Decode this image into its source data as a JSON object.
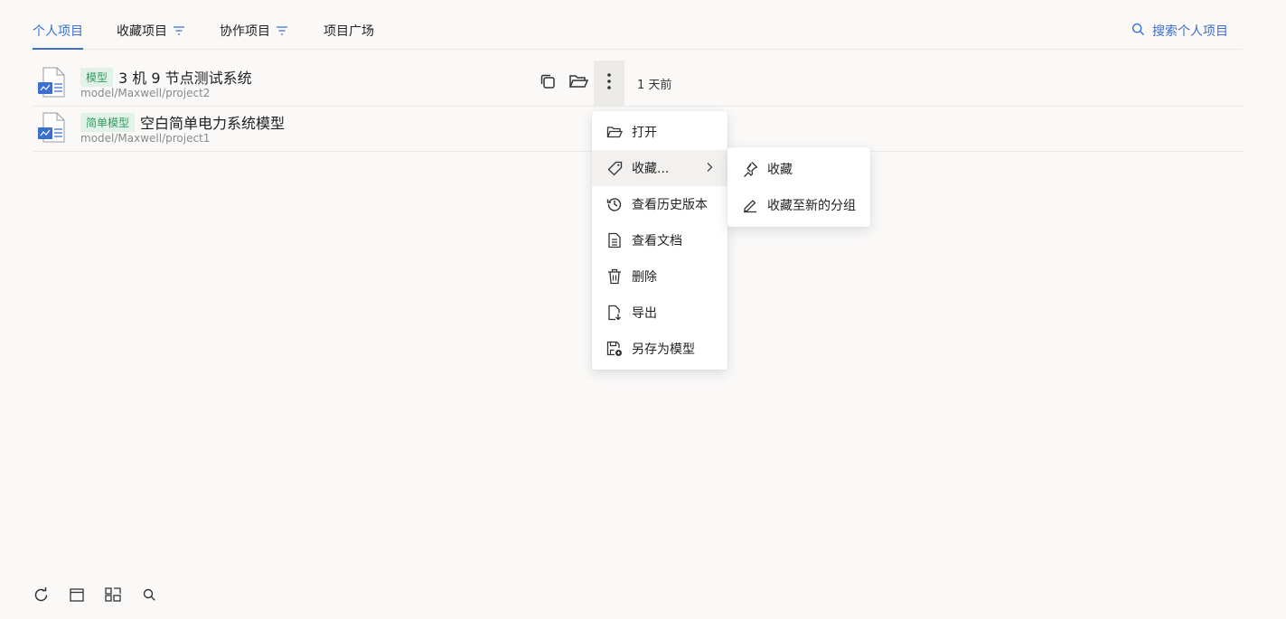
{
  "tabs": [
    {
      "label": "个人项目",
      "active": true
    },
    {
      "label": "收藏项目",
      "filter_icon": "filter-icon"
    },
    {
      "label": "协作项目",
      "filter_icon": "filter-icon"
    },
    {
      "label": "项目广场"
    }
  ],
  "search": {
    "label": "搜索个人项目",
    "icon": "search-icon"
  },
  "projects": [
    {
      "tag": "模型",
      "title": "3 机 9 节点测试系统",
      "path": "model/Maxwell/project2",
      "updated": "1 天前"
    },
    {
      "tag": "简单模型",
      "title": "空白简单电力系统模型",
      "path": "model/Maxwell/project1"
    }
  ],
  "row_actions": [
    "copy-icon",
    "folder-open-icon",
    "more-vertical-icon"
  ],
  "context_menu": {
    "items": [
      {
        "label": "打开",
        "icon": "folder-open-icon"
      },
      {
        "label": "收藏...",
        "icon": "tag-icon",
        "has_submenu": true
      },
      {
        "label": "查看历史版本",
        "icon": "history-icon"
      },
      {
        "label": "查看文档",
        "icon": "document-icon"
      },
      {
        "label": "删除",
        "icon": "trash-icon"
      },
      {
        "label": "导出",
        "icon": "export-icon"
      },
      {
        "label": "另存为模型",
        "icon": "save-as-icon"
      }
    ]
  },
  "submenu": {
    "items": [
      {
        "label": "收藏",
        "icon": "pin-icon"
      },
      {
        "label": "收藏至新的分组",
        "icon": "pencil-icon"
      }
    ]
  },
  "bottom_toolbar": [
    "refresh-icon",
    "window-icon",
    "grid-icon",
    "search-icon"
  ],
  "colors": {
    "accent": "#3a6fd0",
    "tag_bg": "#e3f2e8",
    "tag_text": "#2f9e5e",
    "background": "#faf9f8"
  }
}
